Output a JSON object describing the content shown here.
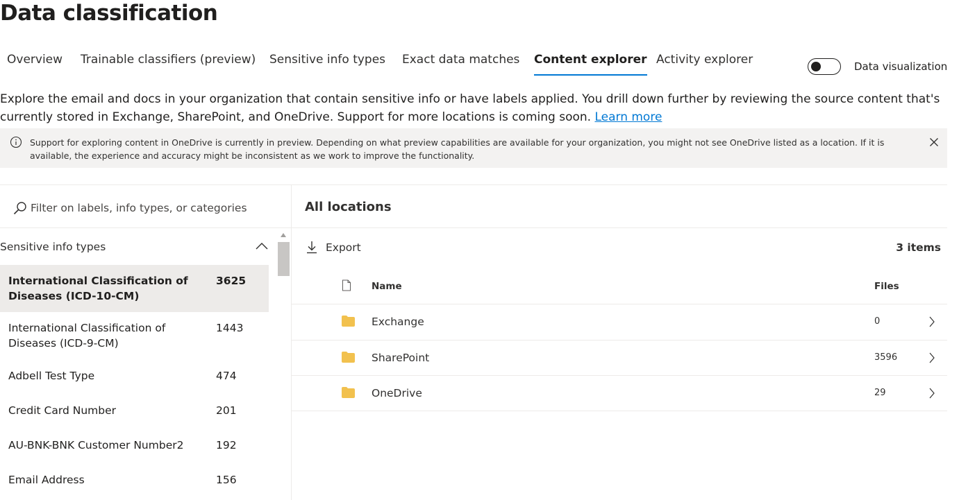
{
  "page": {
    "title": "Data classification"
  },
  "tabs": [
    {
      "label": "Overview"
    },
    {
      "label": "Trainable classifiers (preview)"
    },
    {
      "label": "Sensitive info types"
    },
    {
      "label": "Exact data matches"
    },
    {
      "label": "Content explorer",
      "active": true
    },
    {
      "label": "Activity explorer"
    }
  ],
  "toggle": {
    "label": "Data visualization",
    "on": false
  },
  "description": {
    "text": "Explore the email and docs in your organization that contain sensitive info or have labels applied. You drill down further by reviewing the source content that's currently stored in Exchange, SharePoint, and OneDrive. Support for more locations is coming soon.",
    "link": "Learn more"
  },
  "banner": {
    "icon": "info-icon",
    "text": "Support for exploring content in OneDrive is currently in preview. Depending on what preview capabilities are available for your organization, you might not see OneDrive listed as a location. If it is available, the experience and accuracy might be inconsistent as we work to improve the functionality."
  },
  "filter": {
    "placeholder": "Filter on labels, info types, or categories"
  },
  "sensitive_info": {
    "header": "Sensitive info types",
    "items": [
      {
        "name": "International Classification of Diseases (ICD-10-CM)",
        "count": "3625",
        "selected": true
      },
      {
        "name": "International Classification of Diseases (ICD-9-CM)",
        "count": "1443"
      },
      {
        "name": "Adbell Test Type",
        "count": "474"
      },
      {
        "name": "Credit Card Number",
        "count": "201"
      },
      {
        "name": "AU-BNK-BNK Customer Number2",
        "count": "192"
      },
      {
        "name": "Email Address",
        "count": "156"
      }
    ]
  },
  "locations": {
    "title": "All locations",
    "export_label": "Export",
    "count_label": "3 items",
    "columns": {
      "name": "Name",
      "files": "Files"
    },
    "rows": [
      {
        "name": "Exchange",
        "files": "0"
      },
      {
        "name": "SharePoint",
        "files": "3596"
      },
      {
        "name": "OneDrive",
        "files": "29"
      }
    ]
  },
  "colors": {
    "accent": "#0078d4",
    "folder": "#f2c14e",
    "banner_bg": "#f3f2f1",
    "selected_bg": "#edebe9"
  }
}
